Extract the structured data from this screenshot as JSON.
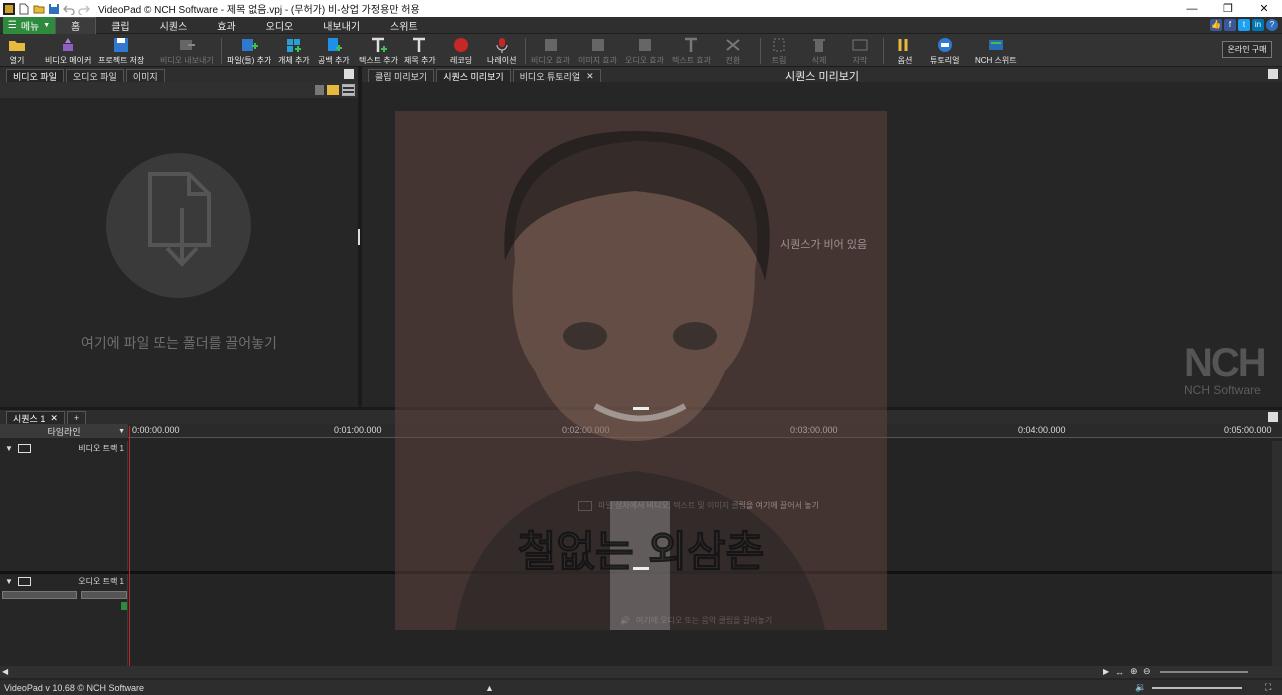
{
  "window": {
    "title": "VideoPad © NCH Software - 제목 없음.vpj - (무허가) 비-상업 가정용만 허용",
    "minimize": "—",
    "restore": "❐",
    "close": "✕"
  },
  "menu": {
    "menu_button": "메뉴",
    "tabs": [
      "홈",
      "클립",
      "시퀀스",
      "효과",
      "오디오",
      "내보내기",
      "스위트"
    ],
    "active_tab": "홈"
  },
  "ribbon": {
    "open": "열기",
    "video_maker": "비디오 메이커",
    "save_project": "프로젝트 저장",
    "export_video": "비디오 내보내기",
    "add_files": "파일(들) 추가",
    "add_objects": "개체 추가",
    "add_blank": "공백 추가",
    "add_text": "텍스트 추가",
    "add_title": "제목 추가",
    "record": "레코딩",
    "narrate": "나레이션",
    "video_effects": "비디오 효과",
    "image_effects": "이미지 효과",
    "audio_effects": "오디오 효과",
    "text_effects": "텍스트 효과",
    "transition": "전환",
    "trim": "트림",
    "delete": "삭제",
    "subtitles": "자막",
    "options": "옵션",
    "tutorial": "튜토리얼",
    "nch_suite": "NCH 스위트",
    "buy_online": "온라인 구매"
  },
  "left_panel": {
    "tabs": [
      "비디오 파일",
      "오디오 파일",
      "이미지"
    ],
    "active_tab": "비디오 파일",
    "drop_hint": "여기에 파일 또는 폴더를 끌어놓기"
  },
  "preview_panel": {
    "tabs": [
      "클립 미리보기",
      "시퀀스 미리보기",
      "비디오 튜토리얼"
    ],
    "active_tab": "시퀀스 미리보기",
    "title": "시퀀스 미리보기",
    "empty_message": "시퀀스가 비어 있음",
    "logo_big": "NCH",
    "logo_small": "NCH Software",
    "overlay_caption": "철없는 외삼촌"
  },
  "timeline": {
    "sequence_tab": "시퀀스 1",
    "add_tab": "+",
    "timeline_label": "타임라인",
    "ticks": [
      "0:00:00.000",
      "0:01:00.000",
      "0:02:00.000",
      "0:03:00.000",
      "0:04:00.000",
      "0:05:00.000"
    ],
    "video_track": "비디오 트랙 1",
    "audio_track": "오디오 트랙 1",
    "video_hint": "파일 상자에서 비디오, 텍스트 및 이미지 클립을 여기에 끌어서 놓기",
    "audio_hint": "여기에 오디오 또는 음악 클립을 끌어놓기"
  },
  "status": {
    "version": "VideoPad v 10.68 © NCH Software"
  },
  "colors": {
    "accent_green": "#2e8b3e",
    "playhead": "#c0282c",
    "record_red": "#c62828"
  }
}
